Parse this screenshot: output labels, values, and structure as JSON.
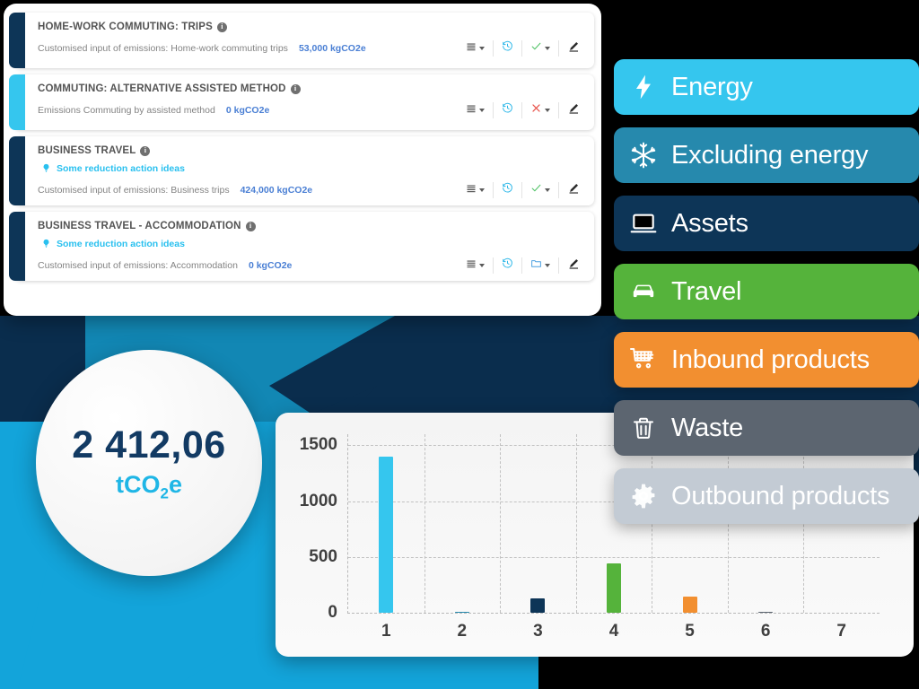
{
  "colors": {
    "navy": "#0d3557",
    "navy_dark": "#0a2d4d",
    "cyan": "#35c6ee",
    "teal": "#1f8fb5",
    "green": "#55b33b",
    "orange": "#f28f30",
    "gray": "#5c6570",
    "gray_light": "#c3cbd4",
    "value_blue": "#4a7fd4",
    "idea_blue": "#29c0ef",
    "title_gray": "#545454",
    "label_gray": "#838383"
  },
  "cards": [
    {
      "title": "HOME-WORK COMMUTING: TRIPS",
      "accent": "#0d3557",
      "idea": null,
      "detail_label": "Customised input of emissions: Home-work commuting trips",
      "detail_value": "53,000 kgCO2e",
      "status_icon": "check-icon",
      "status_color": "#55c46a"
    },
    {
      "title": "COMMUTING: ALTERNATIVE ASSISTED METHOD",
      "accent": "#35c6ee",
      "idea": null,
      "detail_label": "Emissions Commuting by assisted method",
      "detail_value": "0 kgCO2e",
      "status_icon": "cross-icon",
      "status_color": "#e8524a"
    },
    {
      "title": "BUSINESS TRAVEL",
      "accent": "#0d3557",
      "idea": "Some reduction action ideas",
      "detail_label": "Customised input of emissions: Business trips",
      "detail_value": "424,000 kgCO2e",
      "status_icon": "check-icon",
      "status_color": "#55c46a"
    },
    {
      "title": "BUSINESS TRAVEL - ACCOMMODATION",
      "accent": "#0d3557",
      "idea": "Some reduction action ideas",
      "detail_label": "Customised input of emissions: Accommodation",
      "detail_value": "0 kgCO2e",
      "status_icon": "folder-icon",
      "status_color": "#4a9fe0"
    }
  ],
  "card_action_icons": [
    "list-icon",
    "history-icon",
    "status-icon",
    "edit-pencil-icon"
  ],
  "total": {
    "value": "2 412,06",
    "unit_prefix": "tCO",
    "unit_sub": "2",
    "unit_suffix": "e"
  },
  "categories": [
    {
      "label": "Energy",
      "icon": "bolt-icon",
      "bg": "#35c6ee",
      "text": "#ffffff"
    },
    {
      "label": "Excluding energy",
      "icon": "snowflake-icon",
      "bg": "#2689ad",
      "text": "#ffffff"
    },
    {
      "label": "Assets",
      "icon": "laptop-icon",
      "bg": "#0d3557",
      "text": "#ffffff"
    },
    {
      "label": "Travel",
      "icon": "car-icon",
      "bg": "#55b33b",
      "text": "#ffffff"
    },
    {
      "label": "Inbound products",
      "icon": "cart-icon",
      "bg": "#f28f30",
      "text": "#ffffff"
    },
    {
      "label": "Waste",
      "icon": "trash-icon",
      "bg": "#5c6570",
      "text": "#ffffff"
    },
    {
      "label": "Outbound products",
      "icon": "gear-icon",
      "bg": "#c3cbd4",
      "text": "#ffffff"
    }
  ],
  "chart_data": {
    "type": "bar",
    "title": "",
    "xlabel": "",
    "ylabel": "",
    "categories": [
      "1",
      "2",
      "3",
      "4",
      "5",
      "6",
      "7"
    ],
    "values": [
      1400,
      6,
      125,
      440,
      148,
      6,
      0
    ],
    "bar_colors": [
      "#35c6ee",
      "#2689ad",
      "#0d3557",
      "#55b33b",
      "#f28f30",
      "#5c6570",
      "#c3cbd4"
    ],
    "yticks": [
      0,
      500,
      1000,
      1500
    ],
    "ylim": [
      0,
      1600
    ],
    "grid": true,
    "legend": "none"
  }
}
